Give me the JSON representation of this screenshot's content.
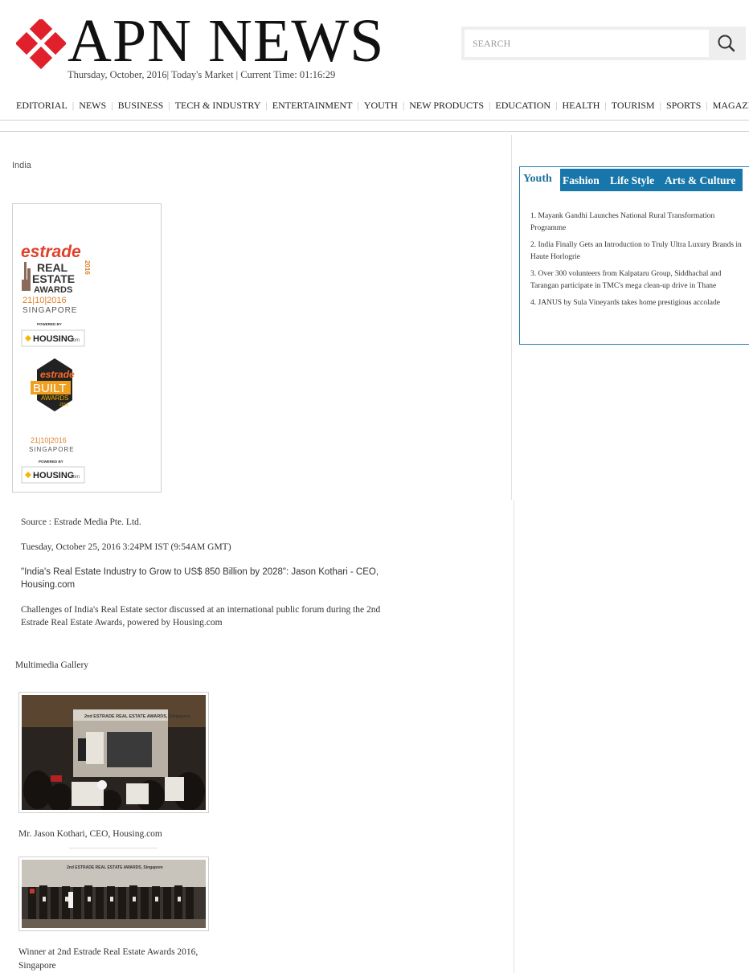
{
  "header": {
    "logo_text": "APN NEWS",
    "date_line": "Thursday, October, 2016| Today's Market | Current Time: 01:16:29",
    "brand_color": "#e0202a",
    "search": {
      "placeholder": "SEARCH",
      "icon": "search-icon"
    }
  },
  "nav": {
    "items": [
      "EDITORIAL",
      "NEWS",
      "BUSINESS",
      "TECH & INDUSTRY",
      "ENTERTAINMENT",
      "YOUTH",
      "NEW PRODUCTS",
      "EDUCATION",
      "HEALTH",
      "TOURISM",
      "SPORTS",
      "MAGAZINE"
    ],
    "separator": "|"
  },
  "article": {
    "location": "India",
    "award_logos": {
      "logo1": {
        "brand": "estrade",
        "lines": [
          "REAL",
          "ESTATE",
          "AWARDS"
        ],
        "year": "2016",
        "date": "21|10|2016",
        "city": "SINGAPORE",
        "powered": "POWERED BY",
        "sponsor": "HOUSING",
        "sponsor_suffix": ".com"
      },
      "logo2": {
        "brand": "estrade",
        "title": "BUILT",
        "sub": "AWARDS",
        "year": "2016",
        "date": "21|10|2016",
        "city": "SINGAPORE",
        "powered": "POWERED BY",
        "sponsor": "HOUSING",
        "sponsor_suffix": ".com"
      }
    },
    "source": "Source : Estrade Media Pte. Ltd.",
    "timestamp": "Tuesday, October 25, 2016 3:24PM IST (9:54AM GMT)",
    "headline": "\"India's Real Estate Industry to Grow to US$ 850 Billion by 2028\": Jason Kothari - CEO, Housing.com",
    "summary": "Challenges of India's Real Estate sector discussed at an international public forum during the 2nd Estrade Real Estate Awards, powered by Housing.com",
    "gallery_title": "Multimedia Gallery",
    "gallery": [
      {
        "caption": "Mr. Jason Kothari, CEO, Housing.com",
        "banner": "2nd ESTRADE REAL ESTATE AWARDS, Singapore"
      },
      {
        "caption": "Winner at 2nd Estrade Real Estate Awards 2016, Singapore",
        "banner": "2nd ESTRADE REAL ESTATE AWARDS, Singapore"
      }
    ]
  },
  "sidebar": {
    "tabs": [
      "Youth",
      "Fashion",
      "Life Style",
      "Arts & Culture"
    ],
    "tab_color": "#1777aa",
    "items": [
      "1. Mayank Gandhi Launches National Rural Transformation Programme",
      "2. India Finally Gets an Introduction to Truly Ultra Luxury Brands in Haute Horlogrie",
      "3. Over 300 volunteers from Kalpataru Group, Siddhachal and Tarangan participate in TMC's mega clean-up drive in Thane",
      "4. JANUS by Sula Vineyards takes home prestigious accolade"
    ]
  }
}
